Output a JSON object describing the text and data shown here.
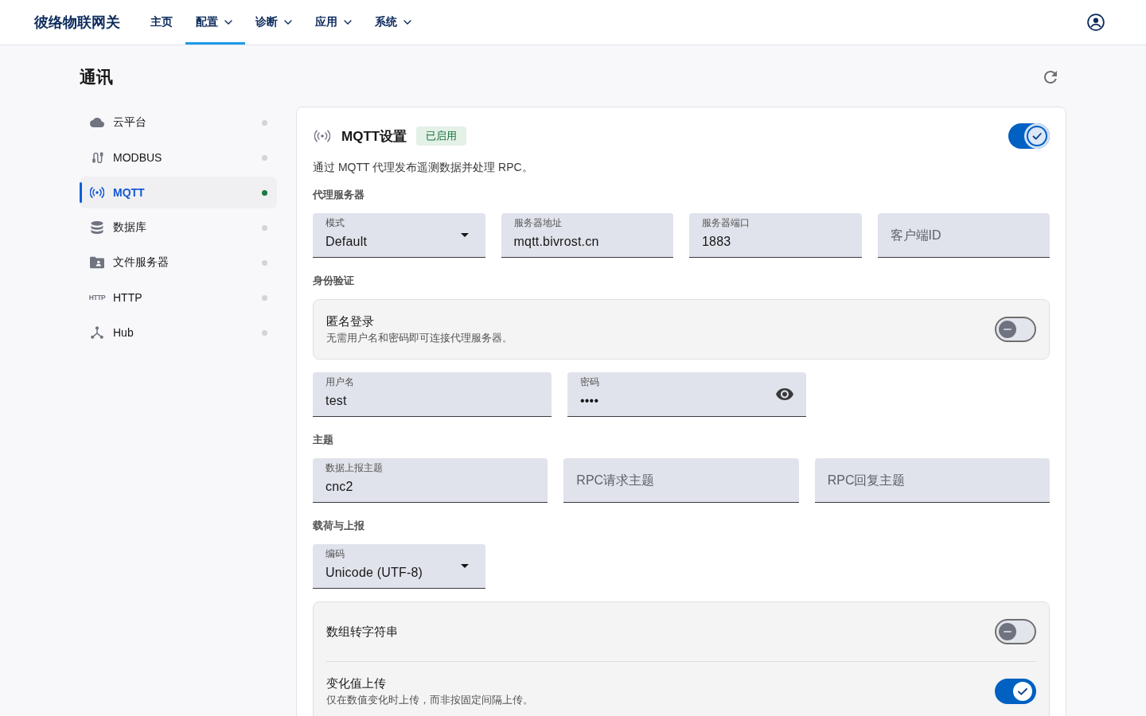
{
  "top_bar": {
    "brand": "彼络物联网关",
    "nav": [
      {
        "label": "主页",
        "has_menu": false,
        "selected": false
      },
      {
        "label": "配置",
        "has_menu": true,
        "selected": true
      },
      {
        "label": "诊断",
        "has_menu": true,
        "selected": false
      },
      {
        "label": "应用",
        "has_menu": true,
        "selected": false
      },
      {
        "label": "系统",
        "has_menu": true,
        "selected": false
      }
    ]
  },
  "page": {
    "title": "通讯"
  },
  "sidebar": {
    "items": [
      {
        "label": "云平台",
        "selected": false,
        "color": "#d4d4d4"
      },
      {
        "label": "MODBUS",
        "selected": false,
        "color": "#d4d4d4"
      },
      {
        "label": "MQTT",
        "selected": true,
        "color": "#1b7a43"
      },
      {
        "label": "数据库",
        "selected": false,
        "color": "#d4d4d4"
      },
      {
        "label": "文件服务器",
        "selected": false,
        "color": "#d4d4d4"
      },
      {
        "label": "HTTP",
        "icon_text": "HTTP",
        "selected": false,
        "color": "#d4d4d4"
      },
      {
        "label": "Hub",
        "selected": false,
        "color": "#d4d4d4"
      }
    ]
  },
  "card": {
    "title": "MQTT设置",
    "badge": "已启用",
    "enabled": true,
    "focused": true,
    "description": "通过 MQTT 代理发布遥测数据并处理 RPC。",
    "sections": [
      {
        "heading": "代理服务器",
        "rows": [
          {
            "kind": "fields",
            "fields": [
              {
                "kind": "select",
                "label": "模式",
                "value": "Default"
              },
              {
                "kind": "text",
                "label": "服务器地址",
                "value": "mqtt.bivrost.cn"
              },
              {
                "kind": "text",
                "label": "服务器端口",
                "value": "1883"
              },
              {
                "kind": "text",
                "placeholder": "客户端ID"
              }
            ]
          }
        ]
      },
      {
        "heading": "身份验证",
        "rows": [
          {
            "kind": "switches",
            "switches": [
              {
                "title": "匿名登录",
                "description": "无需用户名和密码即可连接代理服务器。",
                "on": false
              }
            ]
          },
          {
            "kind": "fields",
            "fields": [
              {
                "kind": "text",
                "label": "用户名",
                "value": "test"
              },
              {
                "kind": "password",
                "label": "密码",
                "value": "••••"
              }
            ]
          }
        ]
      },
      {
        "heading": "主题",
        "rows": [
          {
            "kind": "fields",
            "fields": [
              {
                "kind": "text",
                "label": "数据上报主题",
                "value": "cnc2"
              },
              {
                "kind": "text",
                "placeholder": "RPC请求主题"
              },
              {
                "kind": "text",
                "placeholder": "RPC回复主题"
              }
            ]
          }
        ]
      },
      {
        "heading": "载荷与上报",
        "rows": [
          {
            "kind": "fields",
            "fields": [
              {
                "kind": "select",
                "label": "编码",
                "value": "Unicode (UTF-8)"
              }
            ]
          },
          {
            "kind": "switches",
            "switches": [
              {
                "title": "数组转字符串",
                "on": false
              },
              {
                "title": "变化值上传",
                "description": "仅在数值变化时上传，而非按固定间隔上传。",
                "on": true
              }
            ]
          }
        ]
      }
    ]
  }
}
